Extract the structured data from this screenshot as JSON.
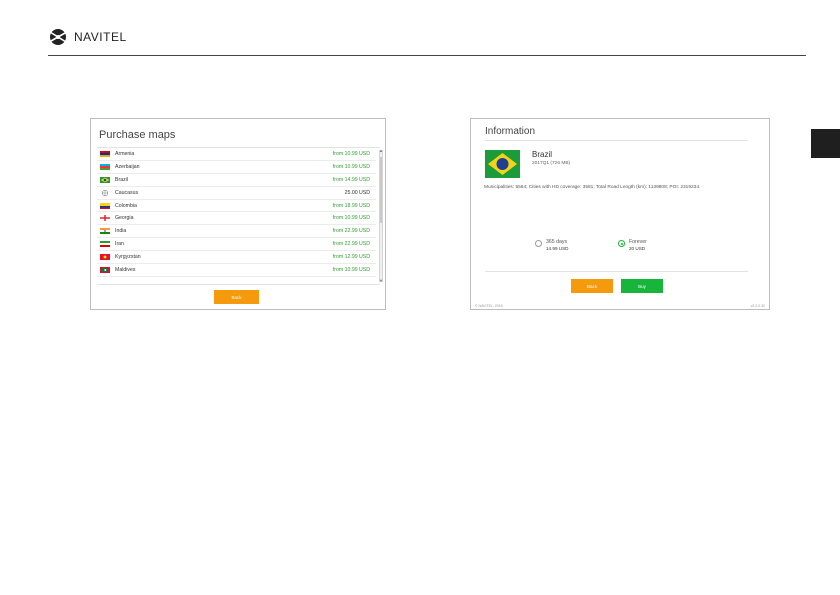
{
  "header": {
    "brand": "NAVITEL",
    "logo_icon": "navitel-logo-icon"
  },
  "purchase_panel": {
    "title": "Purchase maps",
    "items": [
      {
        "country": "Armenia",
        "price": "from 10.99 USD",
        "flag": "armenia",
        "highlight": true
      },
      {
        "country": "Azerbaijan",
        "price": "from 10.99 USD",
        "flag": "azerbaijan",
        "highlight": true
      },
      {
        "country": "Brazil",
        "price": "from 14.99 USD",
        "flag": "brazil",
        "highlight": true
      },
      {
        "country": "Caucasus",
        "price": "25.00 USD",
        "flag": "globe",
        "highlight": false
      },
      {
        "country": "Colombia",
        "price": "from 18.99 USD",
        "flag": "colombia",
        "highlight": true
      },
      {
        "country": "Georgia",
        "price": "from 10.99 USD",
        "flag": "georgia",
        "highlight": true
      },
      {
        "country": "India",
        "price": "from 22.99 USD",
        "flag": "india",
        "highlight": true
      },
      {
        "country": "Iran",
        "price": "from 22.99 USD",
        "flag": "iran",
        "highlight": true
      },
      {
        "country": "Kyrgyzstan",
        "price": "from 12.99 USD",
        "flag": "kyrgyzstan",
        "highlight": true
      },
      {
        "country": "Maldives",
        "price": "from 10.99 USD",
        "flag": "maldives",
        "highlight": true
      }
    ],
    "back_label": "Back"
  },
  "info_panel": {
    "title": "Information",
    "map_name": "Brazil",
    "map_version": "2017Q1 (726 MB)",
    "stats": "Municipalities: 5564; Cities with HD coverage: 3581; Total Road Length (km): 1139808; POI: 2319234.",
    "options": [
      {
        "label": "365 days",
        "price": "14.99 USD",
        "checked": false
      },
      {
        "label": "Forever",
        "price": "20 USD",
        "checked": true
      }
    ],
    "back_label": "Back",
    "buy_label": "Buy",
    "footer_left": "© NAVITEL, 2016",
    "footer_right": "v2.2.0.32"
  },
  "colors": {
    "accent_orange": "#f59a0c",
    "accent_green": "#17b53b",
    "price_green": "#2e9e2e"
  }
}
